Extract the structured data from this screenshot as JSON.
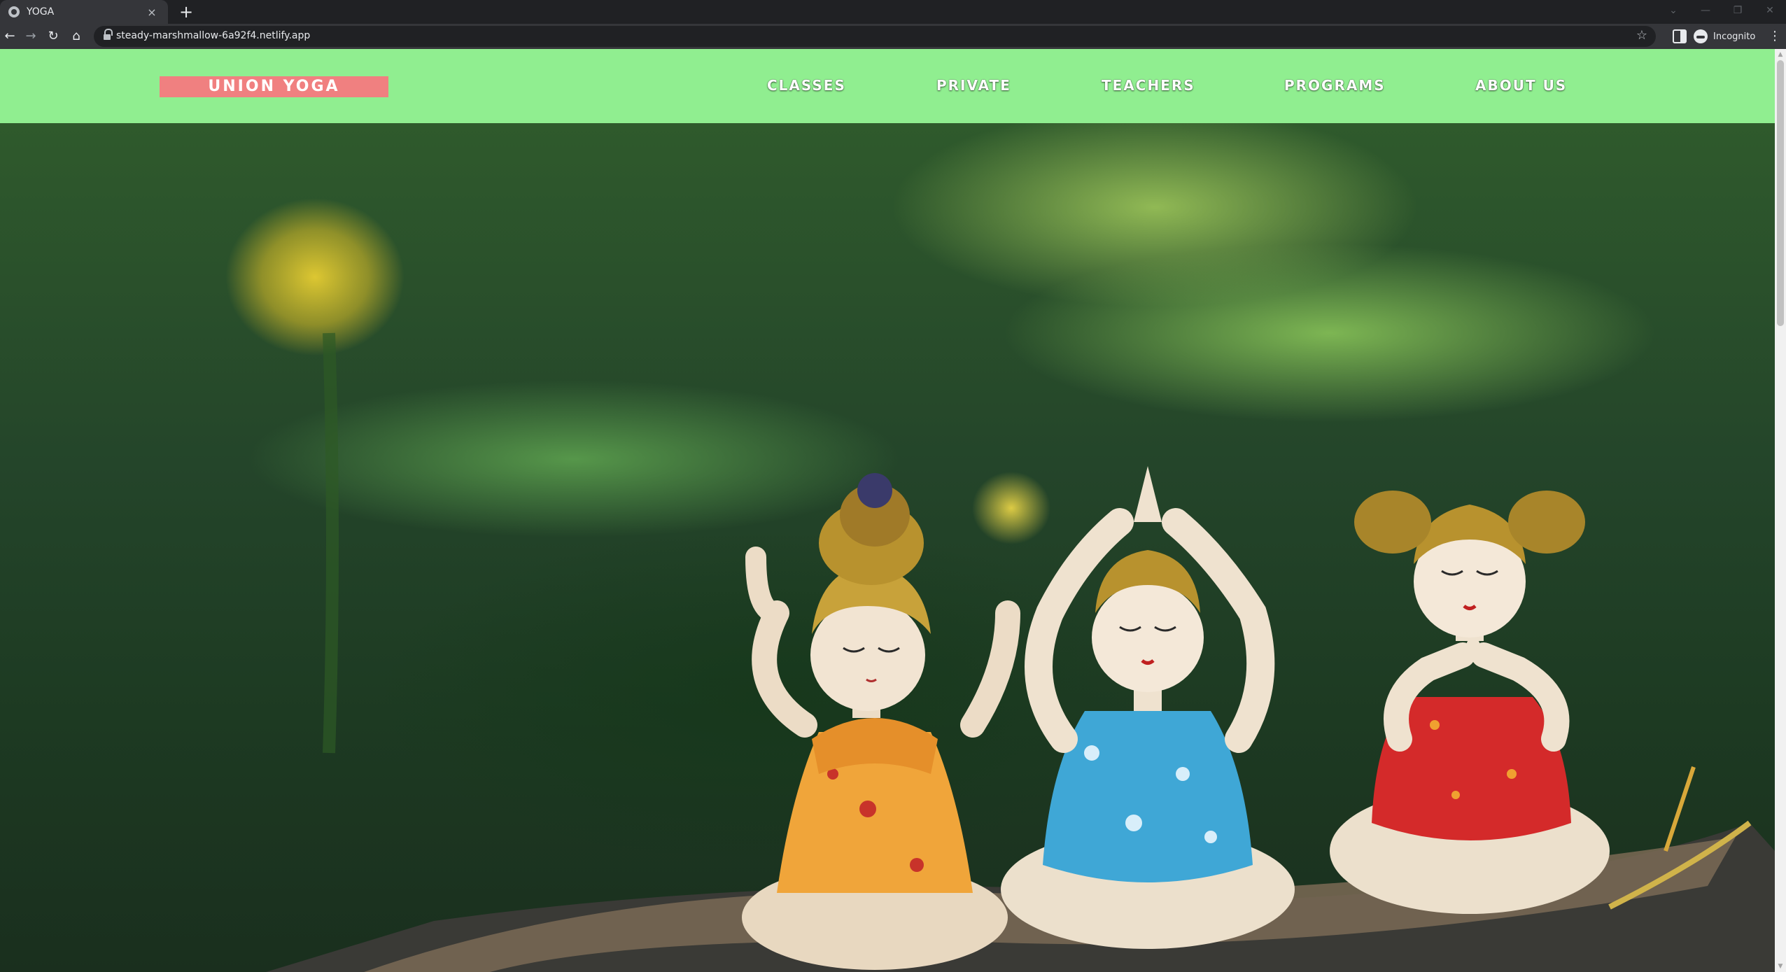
{
  "browser": {
    "tab_title": "YOGA",
    "tab_close": "×",
    "new_tab": "+",
    "window_controls": [
      "⌄",
      "—",
      "❐",
      "✕"
    ],
    "nav_icons": [
      "back-icon",
      "forward-icon",
      "reload-icon",
      "home-icon"
    ],
    "nav_glyphs": [
      "←",
      "→",
      "↻",
      "⌂"
    ],
    "url": "steady-marshmallow-6a92f4.netlify.app",
    "bookmark_star": "☆",
    "incognito_label": "Incognito",
    "menu": "⋮"
  },
  "site": {
    "logo": "UNION YOGA",
    "nav": [
      "CLASSES",
      "PRIVATE",
      "TEACHERS",
      "PROGRAMS",
      "ABOUT US"
    ]
  },
  "hero": {
    "image_subject": "three ceramic yoga figurines (orange, blue, red swimsuits) on a leaf in front of a blurred green pond with yellow water lilies"
  },
  "colors": {
    "header_bg": "#90ee90",
    "logo_bg": "#f08080",
    "nav_text": "#ffffff",
    "browser_dark": "#202124",
    "browser_toolbar": "#35363a"
  }
}
